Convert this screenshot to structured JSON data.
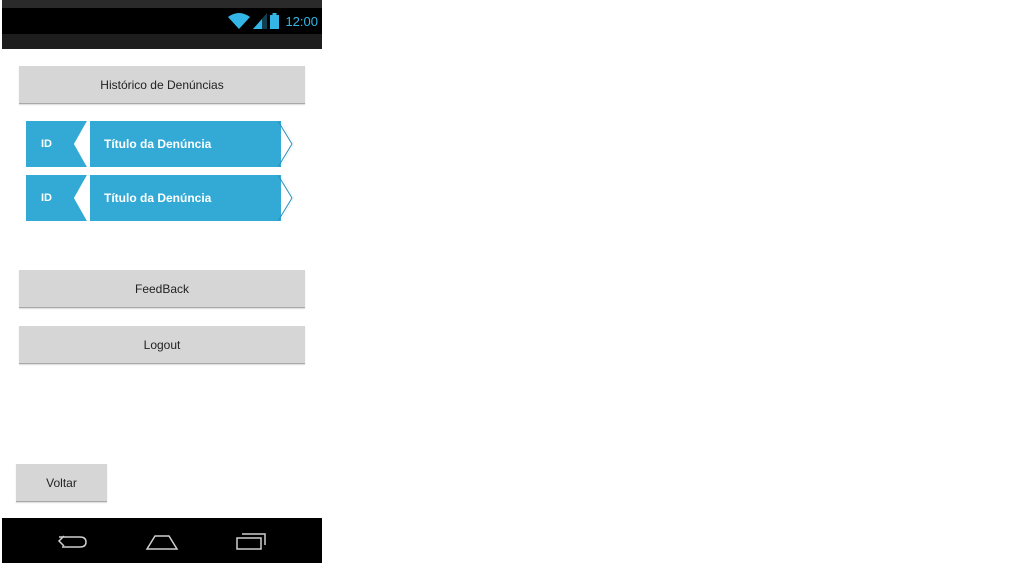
{
  "status_bar": {
    "time": "12:00",
    "icons": [
      "wifi-icon",
      "signal-icon",
      "battery-icon"
    ],
    "accent_color": "#33b5e5"
  },
  "history_button": {
    "label": "Histórico de Denúncias"
  },
  "complaints": [
    {
      "id": "ID",
      "title": "Título da Denúncia"
    },
    {
      "id": "ID",
      "title": "Título da Denúncia"
    }
  ],
  "feedback_button": {
    "label": "FeedBack"
  },
  "logout_button": {
    "label": "Logout"
  },
  "back_button": {
    "label": "Voltar"
  },
  "nav_bar": {
    "icons": [
      "back-arrow-icon",
      "home-icon",
      "recent-apps-icon"
    ]
  },
  "colors": {
    "item_blue": "#33aad6",
    "button_gray": "#d6d6d6"
  }
}
